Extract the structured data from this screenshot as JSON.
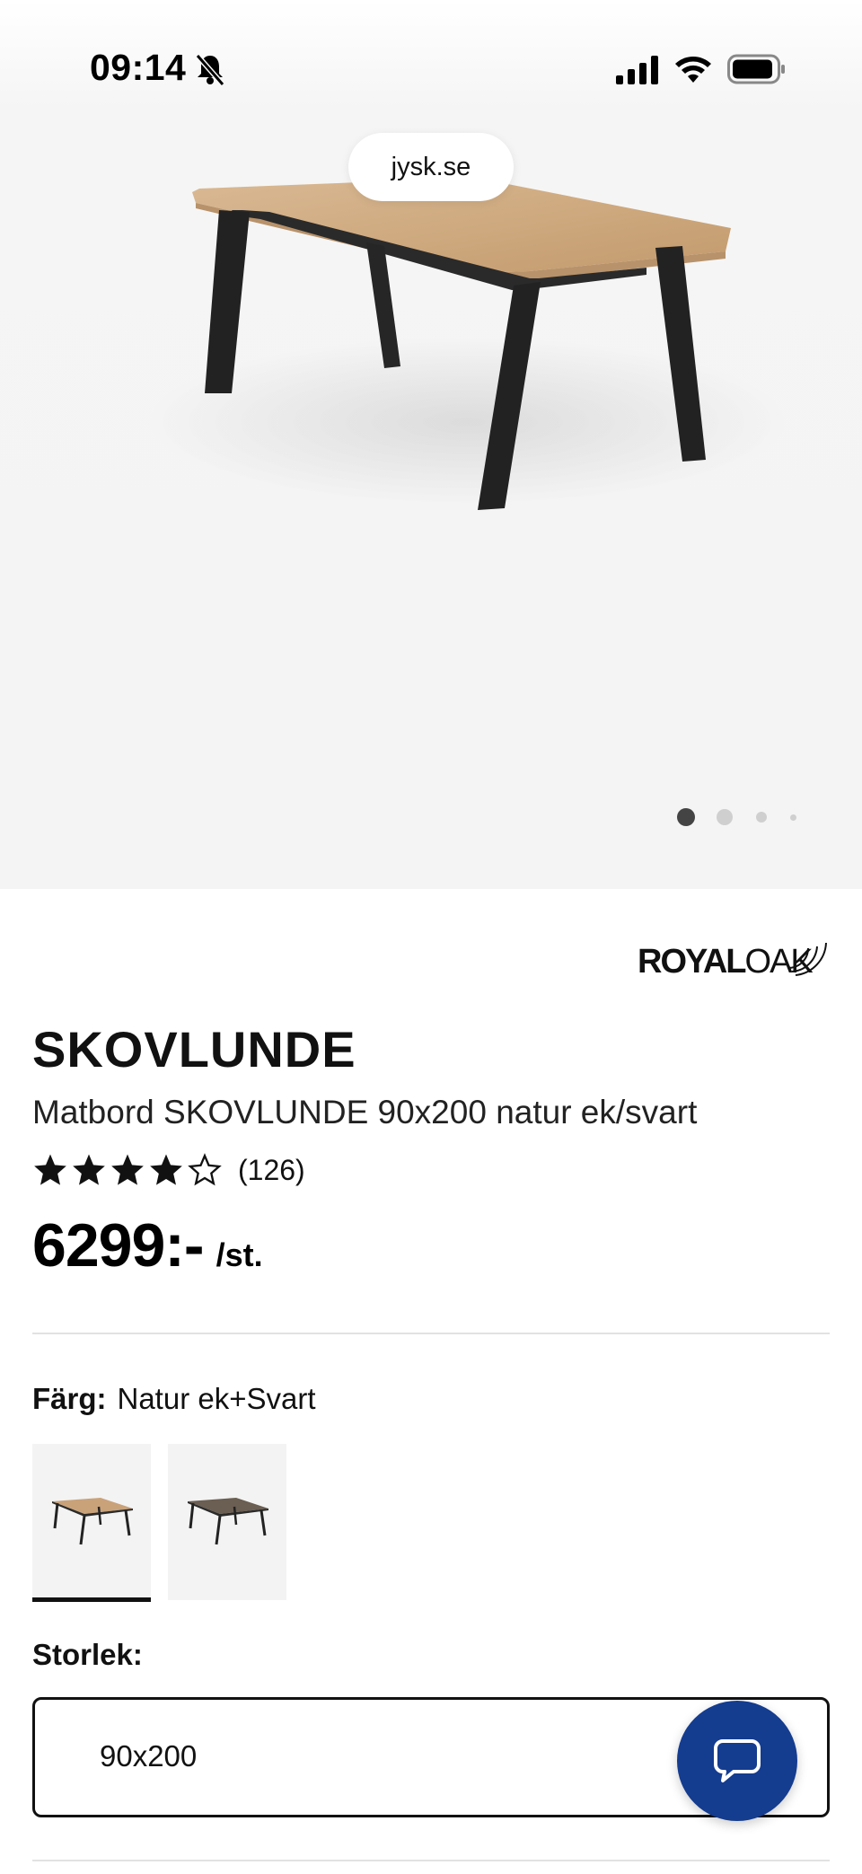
{
  "status_bar": {
    "time": "09:14",
    "icons": [
      "bell-slash-icon",
      "signal-icon",
      "wifi-icon",
      "battery-icon"
    ]
  },
  "browser": {
    "url": "jysk.se"
  },
  "gallery": {
    "image": "dining-table-image",
    "active_index": 1,
    "total_images": 4
  },
  "brand": {
    "logo_text_bold": "ROYAL",
    "logo_text_light": "OAK"
  },
  "product": {
    "name": "SKOVLUNDE",
    "description": "Matbord SKOVLUNDE 90x200 natur ek/svart",
    "rating": 4,
    "rating_max": 5,
    "review_count": "(126)",
    "price": "6299:-",
    "unit": "/st."
  },
  "color_option": {
    "label": "Färg:",
    "value": "Natur ek+Svart",
    "swatches": [
      {
        "name": "natur-ek-svart",
        "selected": true,
        "top_color": "#c9a27a"
      },
      {
        "name": "mork-ek-svart",
        "selected": false,
        "top_color": "#6b5e52"
      }
    ]
  },
  "size_option": {
    "label": "Storlek:",
    "value": "90x200"
  },
  "chat": {
    "icon": "chat-bubble-icon",
    "color": "#143c8f"
  }
}
